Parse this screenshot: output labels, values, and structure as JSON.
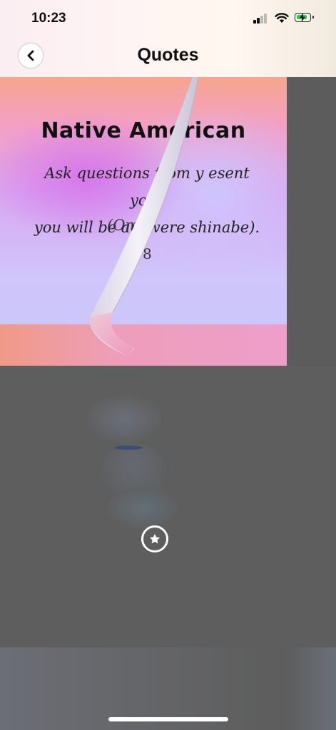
{
  "status_bar": {
    "time": "10:23"
  },
  "header": {
    "back_icon": "chevron-left-icon",
    "title": "Quotes"
  },
  "quote": {
    "title": "Native American",
    "line1": "Ask questions from y   esent your",
    "line2": "you will be answere      shinabe).",
    "attribution": "(Om",
    "mark": "8"
  },
  "actions": {
    "favorite_icon": "star-icon"
  },
  "colors": {
    "battery": "#35c759",
    "overlay": "#5c5c5c"
  }
}
